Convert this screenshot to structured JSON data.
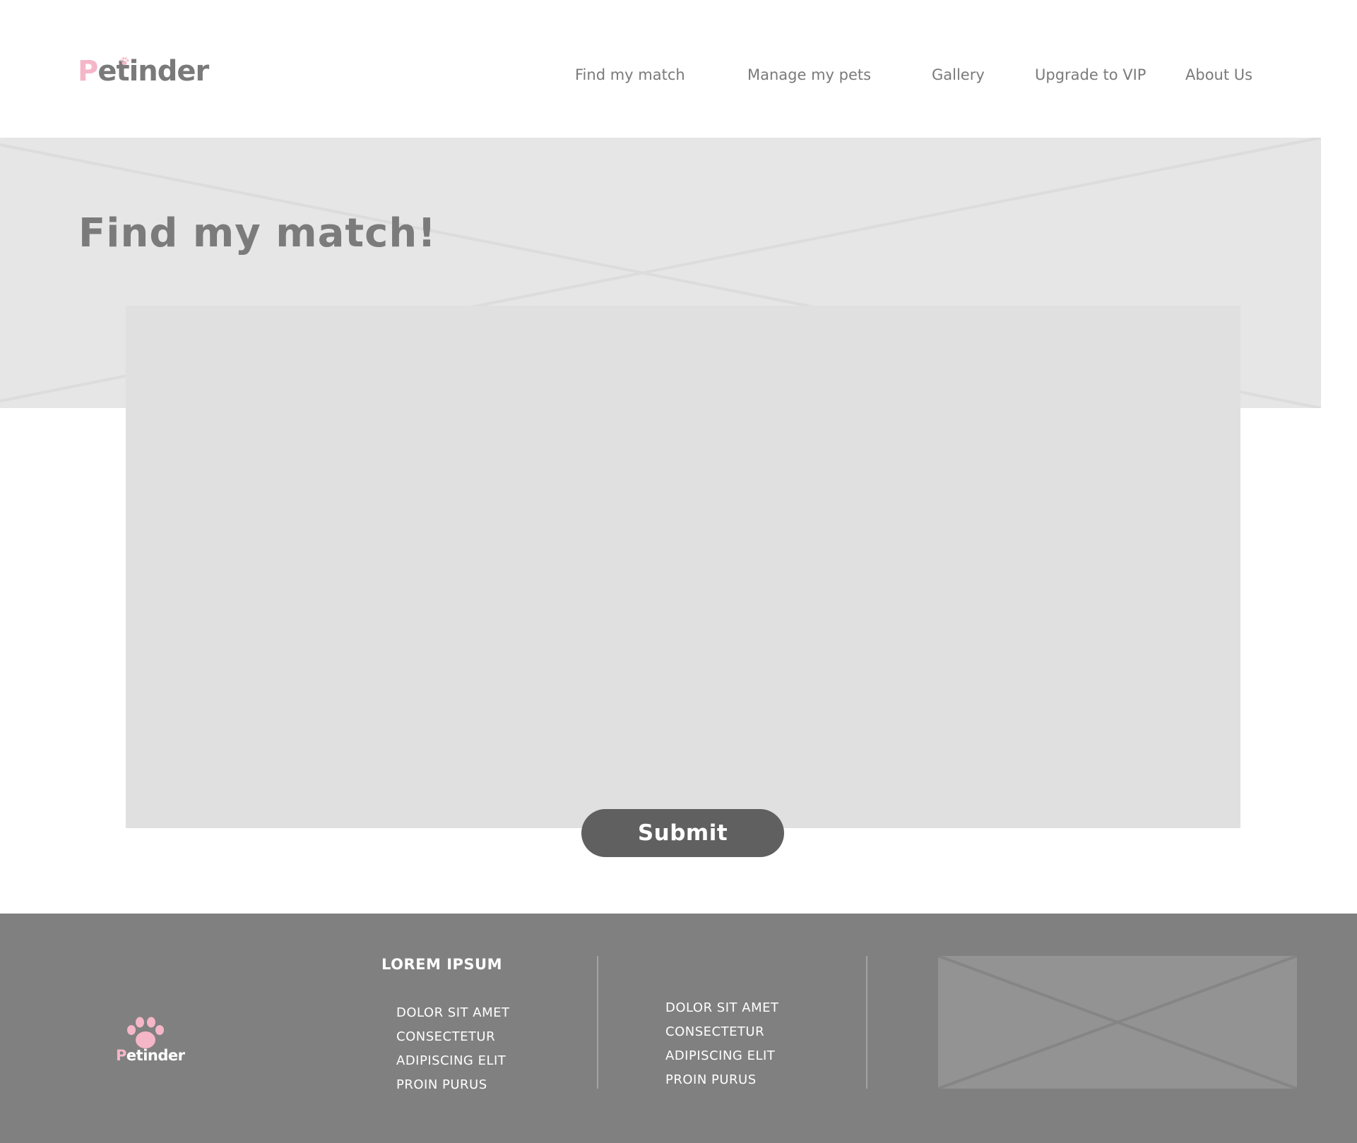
{
  "header": {
    "logo": {
      "first_letter": "P",
      "rest": "etinder"
    },
    "nav": [
      {
        "label": "Find my match"
      },
      {
        "label": "Manage my pets"
      },
      {
        "label": "Gallery"
      },
      {
        "label": "Upgrade to VIP"
      },
      {
        "label": "About Us"
      }
    ]
  },
  "hero": {
    "title": "Find my match!"
  },
  "form": {
    "submit_label": "Submit"
  },
  "footer": {
    "logo": {
      "first_letter": "P",
      "rest": "etinder"
    },
    "heading": "LOREM IPSUM",
    "column1": [
      "DOLOR SIT AMET",
      "CONSECTETUR",
      "ADIPISCING ELIT",
      "PROIN PURUS"
    ],
    "column2": [
      "DOLOR SIT AMET",
      "CONSECTETUR",
      "ADIPISCING ELIT",
      "PROIN PURUS"
    ]
  },
  "colors": {
    "brand_pink": "#f5b6c8",
    "text_gray": "#7a7a7a",
    "footer_bg": "#808080",
    "button_bg": "#606060"
  }
}
